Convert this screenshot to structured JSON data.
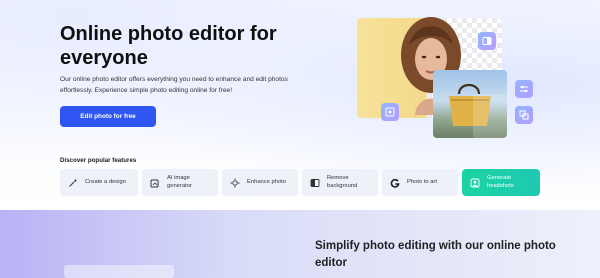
{
  "hero": {
    "headline": "Online photo editor for everyone",
    "subtext": "Our online photo editor offers everything you need to enhance and edit photos effortlessly. Experience simple photo editing online for free!",
    "cta_label": "Edit photo for free"
  },
  "features": {
    "title": "Discover popular features",
    "items": [
      {
        "label": "Create a design",
        "icon": "magic-wand-icon"
      },
      {
        "label": "AI image generator",
        "icon": "ai-image-icon"
      },
      {
        "label": "Enhance photo",
        "icon": "sparkle-icon"
      },
      {
        "label": "Remove background",
        "icon": "remove-bg-icon"
      },
      {
        "label": "Photo to art",
        "icon": "g-logo-icon"
      },
      {
        "label": "Generate headshots",
        "icon": "person-icon"
      }
    ]
  },
  "section": {
    "title": "Simplify photo editing with our online photo editor"
  },
  "colors": {
    "primary": "#2f55f3",
    "accent_green": "#1bd3a3",
    "chip_bg": "#eef1f8"
  }
}
